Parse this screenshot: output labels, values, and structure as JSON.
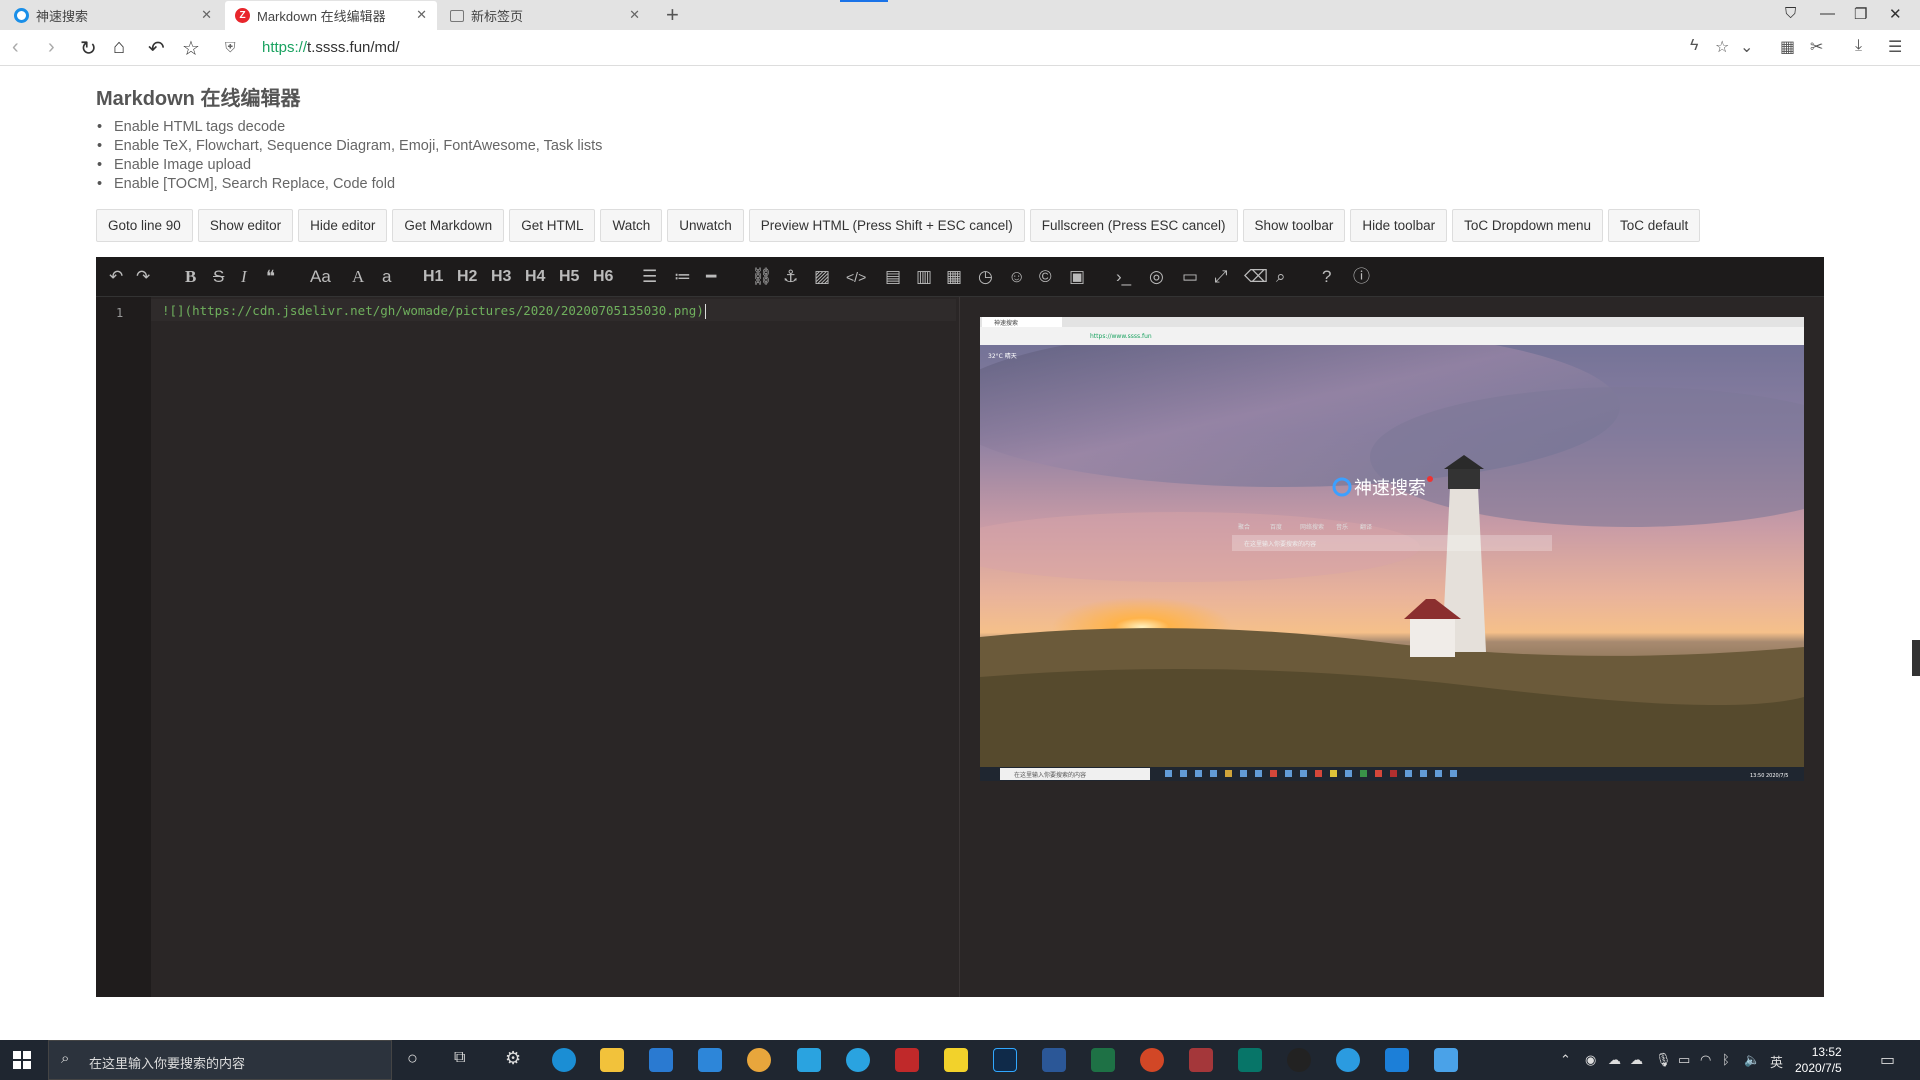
{
  "browser": {
    "tabs": [
      {
        "title": "神速搜索"
      },
      {
        "title": "Markdown 在线编辑器"
      },
      {
        "title": "新标签页"
      }
    ],
    "url_scheme": "https://",
    "url_rest": "t.ssss.fun/md/"
  },
  "page": {
    "title": "Markdown 在线编辑器",
    "features": [
      "Enable HTML tags decode",
      "Enable TeX, Flowchart, Sequence Diagram, Emoji, FontAwesome, Task lists",
      "Enable Image upload",
      "Enable [TOCM], Search Replace, Code fold"
    ],
    "buttons": [
      "Goto line 90",
      "Show editor",
      "Hide editor",
      "Get Markdown",
      "Get HTML",
      "Watch",
      "Unwatch",
      "Preview HTML (Press Shift + ESC cancel)",
      "Fullscreen (Press ESC cancel)",
      "Show toolbar",
      "Hide toolbar",
      "ToC Dropdown menu",
      "ToC default"
    ]
  },
  "editor": {
    "toolbar": {
      "undo": "↶",
      "redo": "↷",
      "bold": "B",
      "strike": "S",
      "italic": "I",
      "quote": "❝",
      "ucwords": "Aa",
      "uppercase": "A",
      "lowercase": "a",
      "h1": "H1",
      "h2": "H2",
      "h3": "H3",
      "h4": "H4",
      "h5": "H5",
      "h6": "H6"
    },
    "line_number": "1",
    "code_line": "![](https://cdn.jsdelivr.net/gh/womade/pictures/2020/20200705135030.png)"
  },
  "preview": {
    "inner_tab": "神速搜索",
    "inner_url": "https://www.ssss.fun",
    "weather": "32°C 晴天",
    "logo_text": "神速搜索",
    "search_tabs": [
      "聚合",
      "百度",
      "网络搜索",
      "音乐",
      "翻译"
    ],
    "search_placeholder": "在这里输入你要搜索的内容",
    "inner_taskbar_search": "在这里输入你要搜索的内容",
    "inner_clock": "13:50 2020/7/5"
  },
  "taskbar": {
    "search_placeholder": "在这里输入你要搜索的内容",
    "ime": "英",
    "time": "13:52",
    "date": "2020/7/5"
  }
}
